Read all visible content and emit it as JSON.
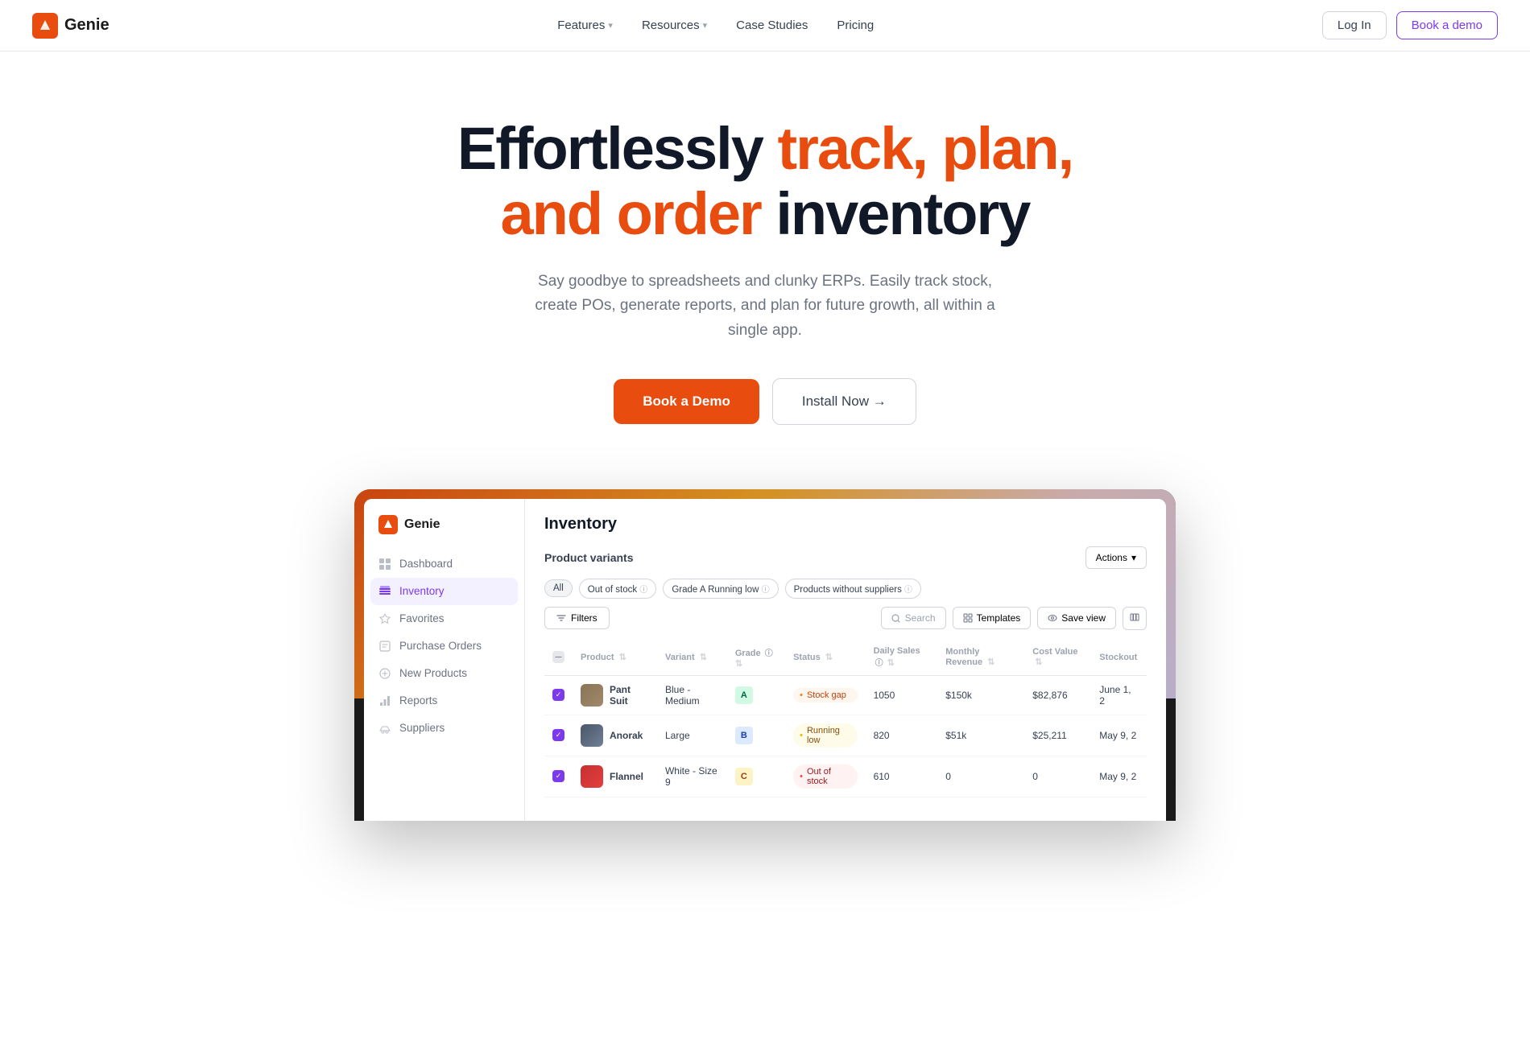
{
  "brand": {
    "name": "Genie",
    "logo_alt": "Genie logo"
  },
  "nav": {
    "links": [
      {
        "label": "Features",
        "has_dropdown": true
      },
      {
        "label": "Resources",
        "has_dropdown": true
      },
      {
        "label": "Case Studies",
        "has_dropdown": false
      },
      {
        "label": "Pricing",
        "has_dropdown": false
      }
    ],
    "login_label": "Log In",
    "book_demo_label": "Book a demo"
  },
  "hero": {
    "headline_black1": "Effortlessly",
    "headline_orange": "track, plan,",
    "headline_line2_orange": "and order",
    "headline_black2": "inventory",
    "subtext": "Say goodbye to spreadsheets and clunky ERPs. Easily track stock, create POs, generate reports, and plan for future growth, all within a single app.",
    "cta_primary": "Book a Demo",
    "cta_secondary": "Install Now →"
  },
  "app_screenshot": {
    "app_title": "Inventory",
    "sidebar": {
      "logo": "Genie",
      "items": [
        {
          "label": "Dashboard",
          "icon": "dashboard-icon",
          "active": false
        },
        {
          "label": "Inventory",
          "icon": "inventory-icon",
          "active": true
        },
        {
          "label": "Favorites",
          "icon": "favorites-icon",
          "active": false
        },
        {
          "label": "Purchase Orders",
          "icon": "purchase-orders-icon",
          "active": false
        },
        {
          "label": "New Products",
          "icon": "new-products-icon",
          "active": false
        },
        {
          "label": "Reports",
          "icon": "reports-icon",
          "active": false
        },
        {
          "label": "Suppliers",
          "icon": "suppliers-icon",
          "active": false
        }
      ]
    },
    "table": {
      "section_title": "Product variants",
      "actions_label": "Actions",
      "filters": [
        "All",
        "Out of stock",
        "Grade A Running low",
        "Products without suppliers"
      ],
      "filter_button": "Filters",
      "search_placeholder": "Search",
      "templates_label": "Templates",
      "save_view_label": "Save view",
      "columns": [
        "Product",
        "Variant",
        "Grade",
        "Status",
        "Daily Sales",
        "Monthly Revenue",
        "Cost Value",
        "Stockout"
      ],
      "rows": [
        {
          "product": "Pant Suit",
          "img_class": "product-img-suit",
          "variant": "Blue - Medium",
          "grade": "A",
          "grade_class": "grade-a",
          "status": "Stock gap",
          "status_class": "status-gap",
          "daily_sales": "1050",
          "monthly_revenue": "$150k",
          "cost_value": "$82,876",
          "stockout": "June 1, 2"
        },
        {
          "product": "Anorak",
          "img_class": "product-img-anorak",
          "variant": "Large",
          "grade": "B",
          "grade_class": "grade-b",
          "status": "Running low",
          "status_class": "status-low",
          "daily_sales": "820",
          "monthly_revenue": "$51k",
          "cost_value": "$25,211",
          "stockout": "May 9, 2"
        },
        {
          "product": "Flannel",
          "img_class": "product-img-flannel",
          "variant": "White - Size 9",
          "grade": "C",
          "grade_class": "grade-c",
          "status": "Out of stock",
          "status_class": "status-out",
          "daily_sales": "610",
          "monthly_revenue": "0",
          "cost_value": "0",
          "stockout": "May 9, 2"
        }
      ]
    }
  },
  "colors": {
    "orange": "#e84c0e",
    "purple": "#7c3aed",
    "black": "#111827",
    "gray": "#6b7280"
  }
}
